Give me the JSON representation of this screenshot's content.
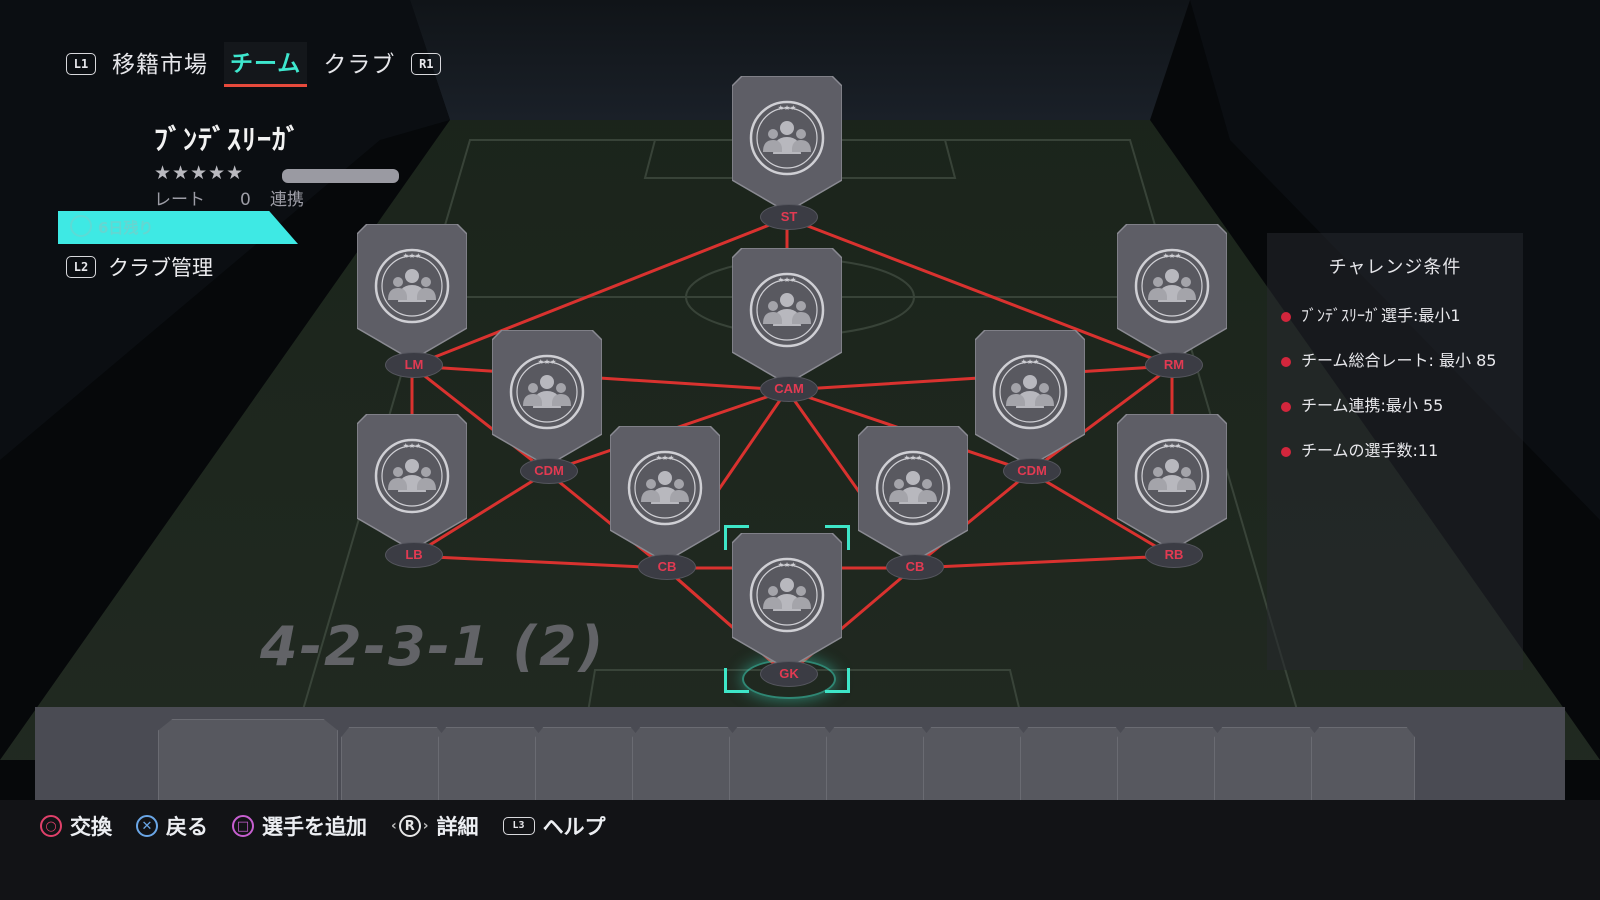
{
  "nav": {
    "left_button": "L1",
    "right_button": "R1",
    "tabs": [
      {
        "label": "移籍市場",
        "active": false
      },
      {
        "label": "チーム",
        "active": true
      },
      {
        "label": "クラブ",
        "active": false
      }
    ]
  },
  "squad": {
    "name": "ﾌﾞﾝﾃﾞｽﾘｰｶﾞ",
    "stars": "★★★★★",
    "rate_label": "レート",
    "rate_value": "0",
    "chem_label": "連携",
    "timer_text": "6日残り"
  },
  "club_manage": {
    "button": "L2",
    "label": "クラブ管理"
  },
  "conditions": {
    "title": "チャレンジ条件",
    "items": [
      "ﾌﾞﾝﾃﾞｽﾘｰｶﾞ選手:最小1",
      "チーム総合レート: 最小 85",
      "チーム連携:最小 55",
      "チームの選手数:11"
    ]
  },
  "formation": "4-2-3-1 (2)",
  "positions": [
    "ST",
    "LM",
    "CAM",
    "RM",
    "CDM",
    "CDM",
    "LB",
    "CB",
    "CB",
    "RB",
    "GK"
  ],
  "selected_position": "GK",
  "bench": {
    "slots": 12
  },
  "footer": {
    "hints": [
      {
        "label": "交換",
        "icon": "circle-button-icon"
      },
      {
        "label": "戻る",
        "icon": "cross-button-icon"
      },
      {
        "label": "選手を追加",
        "icon": "square-button-icon"
      },
      {
        "label": "詳細",
        "icon": "right-stick-icon",
        "badge": "R"
      },
      {
        "label": "ヘルプ",
        "icon": "l3-stick-icon",
        "badge": "L3"
      }
    ]
  },
  "colors": {
    "accent": "#3ee7ce",
    "link_line": "#d9322f",
    "position_text": "#e23a52",
    "condition_dot": "#d2263c",
    "card_fill": "#6a6a72"
  }
}
